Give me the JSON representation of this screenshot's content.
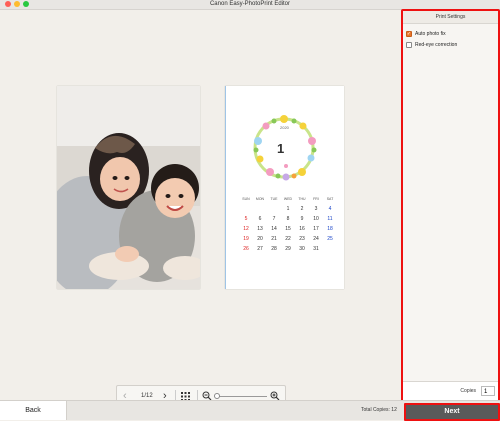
{
  "window": {
    "title": "Canon Easy-PhotoPrint Editor"
  },
  "calendar": {
    "year": "2020",
    "month": "1",
    "weekdays": [
      "SUN",
      "MON",
      "TUE",
      "WED",
      "THU",
      "FRI",
      "SAT"
    ],
    "weeks": [
      [
        "",
        "",
        "",
        "1",
        "2",
        "3",
        "4"
      ],
      [
        "5",
        "6",
        "7",
        "8",
        "9",
        "10",
        "11"
      ],
      [
        "12",
        "13",
        "14",
        "15",
        "16",
        "17",
        "18"
      ],
      [
        "19",
        "20",
        "21",
        "22",
        "23",
        "24",
        "25"
      ],
      [
        "26",
        "27",
        "28",
        "29",
        "30",
        "31",
        ""
      ]
    ],
    "colors": {
      "sunday": "#dd2222",
      "saturday": "#1a44c8"
    }
  },
  "toolbar": {
    "page_indicator": "1/12"
  },
  "panel": {
    "title": "Print Settings",
    "options": [
      {
        "label": "Auto photo fix",
        "checked": true
      },
      {
        "label": "Red-eye correction",
        "checked": false
      }
    ],
    "copies_label": "Copies",
    "copies_value": "1"
  },
  "footer": {
    "back_label": "Back",
    "total_copies": "Total Copies: 12",
    "next_label": "Next"
  },
  "colors": {
    "highlight": "#ee1111",
    "checkbox_on": "#e8742a"
  }
}
